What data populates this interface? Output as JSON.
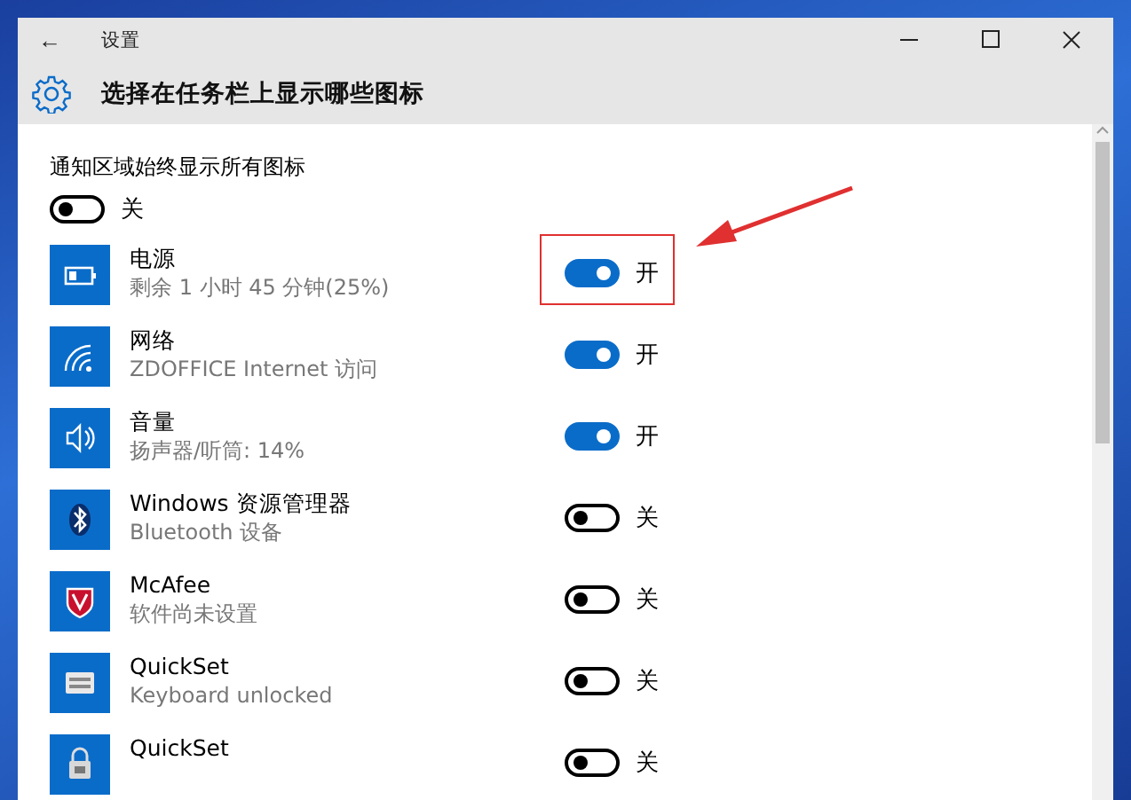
{
  "window": {
    "title": "设置",
    "back": "←"
  },
  "page": {
    "title": "选择在任务栏上显示哪些图标"
  },
  "always_show": {
    "label": "通知区域始终显示所有图标",
    "on": false,
    "state_text": "关"
  },
  "items": [
    {
      "name": "电源",
      "detail": "剩余 1 小时 45 分钟(25%)",
      "on": true,
      "state_text": "开",
      "highlighted": true
    },
    {
      "name": "网络",
      "detail": "ZDOFFICE Internet 访问",
      "on": true,
      "state_text": "开",
      "highlighted": false
    },
    {
      "name": "音量",
      "detail": "扬声器/听筒: 14%",
      "on": true,
      "state_text": "开",
      "highlighted": false
    },
    {
      "name": "Windows 资源管理器",
      "detail": "Bluetooth 设备",
      "on": false,
      "state_text": "关",
      "highlighted": false
    },
    {
      "name": "McAfee",
      "detail": "软件尚未设置",
      "on": false,
      "state_text": "关",
      "highlighted": false
    },
    {
      "name": "QuickSet",
      "detail": "Keyboard unlocked",
      "on": false,
      "state_text": "关",
      "highlighted": false
    },
    {
      "name": "QuickSet",
      "on": false,
      "state_text": "关",
      "highlighted": false
    }
  ]
}
